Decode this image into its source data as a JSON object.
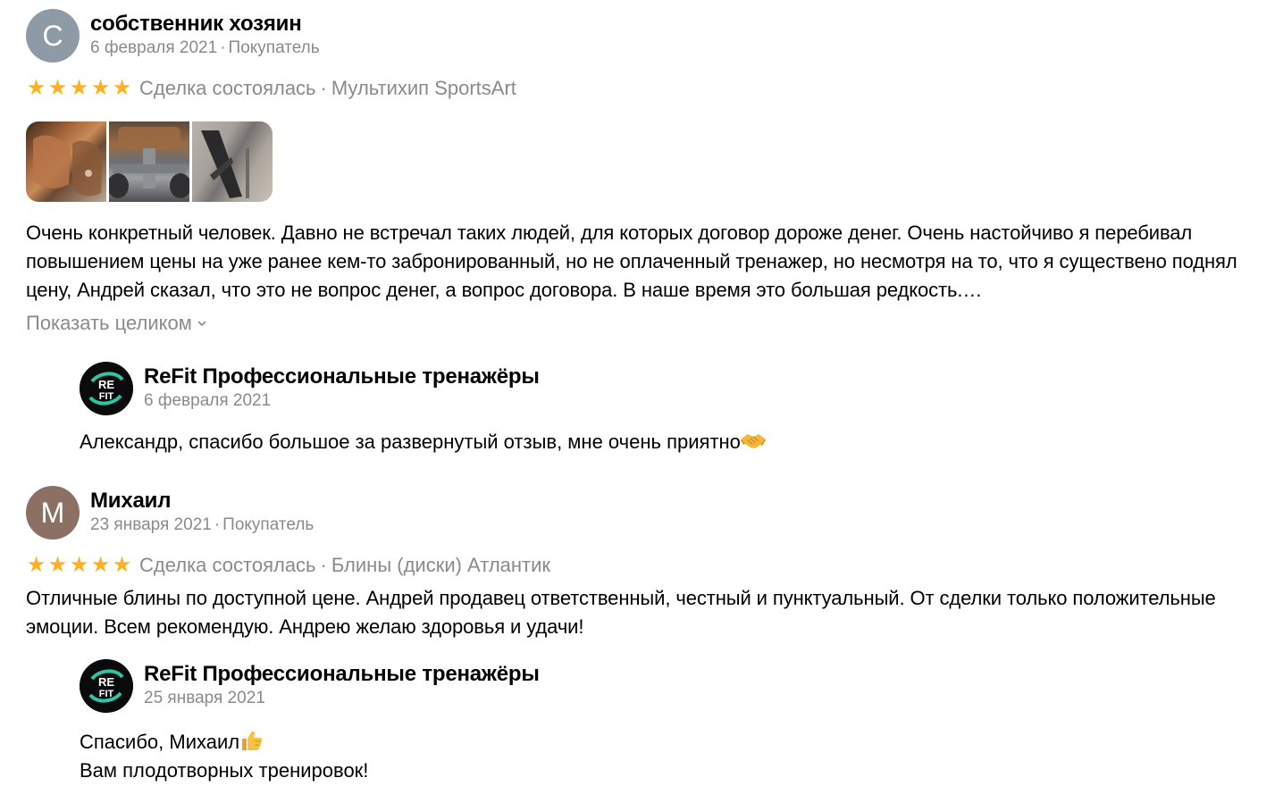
{
  "reviews": [
    {
      "avatar_letter": "С",
      "avatar_color": "#8f9aa7",
      "author": "собственник хозяин",
      "date": "6 февраля 2021",
      "role": "Покупатель",
      "rating": 5,
      "deal_status": "Сделка состоялась",
      "item": "Мультихип SportsArt",
      "photos": [
        "photo-1",
        "photo-2",
        "photo-3"
      ],
      "text": "Очень конкретный человек. Давно не встречал таких людей, для которых договор дороже денег. Очень настойчиво я перебивал повышением цены на уже ранее кем-то забронированный, но не оплаченный тренажер, но несмотря на то, что я существено поднял цену, Андрей сказал, что это не вопрос денег, а вопрос договора. В наше время это большая редкость.…",
      "show_more": "Показать целиком",
      "reply": {
        "shop_name": "ReFit Профессиональные тренажёры",
        "date": "6 февраля 2021",
        "text_line1": "Александр, спасибо большое за развернутый отзыв, мне очень приятно",
        "text_line2": "",
        "emoji": "handshake-icon"
      }
    },
    {
      "avatar_letter": "М",
      "avatar_color": "#8d7064",
      "author": "Михаил",
      "date": "23 января 2021",
      "role": "Покупатель",
      "rating": 5,
      "deal_status": "Сделка состоялась",
      "item": "Блины (диски) Атлантик",
      "text": "Отличные блины по доступной цене. Андрей продавец ответственный, честный и пунктуальный. От сделки только положительные эмоции. Всем рекомендую. Андрею желаю здоровья и удачи!",
      "reply": {
        "shop_name": "ReFit Профессиональные тренажёры",
        "date": "25 января 2021",
        "text_line1": "Спасибо, Михаил",
        "text_line2": "Вам плодотворных тренировок!",
        "emoji": "thumbs-up-icon"
      }
    }
  ],
  "shop_logo_text": [
    "RE",
    "FIT"
  ],
  "colors": {
    "star": "#ffb021",
    "muted": "#8a8a8a",
    "logo_accent": "#2ec4a6"
  },
  "separator": "·"
}
